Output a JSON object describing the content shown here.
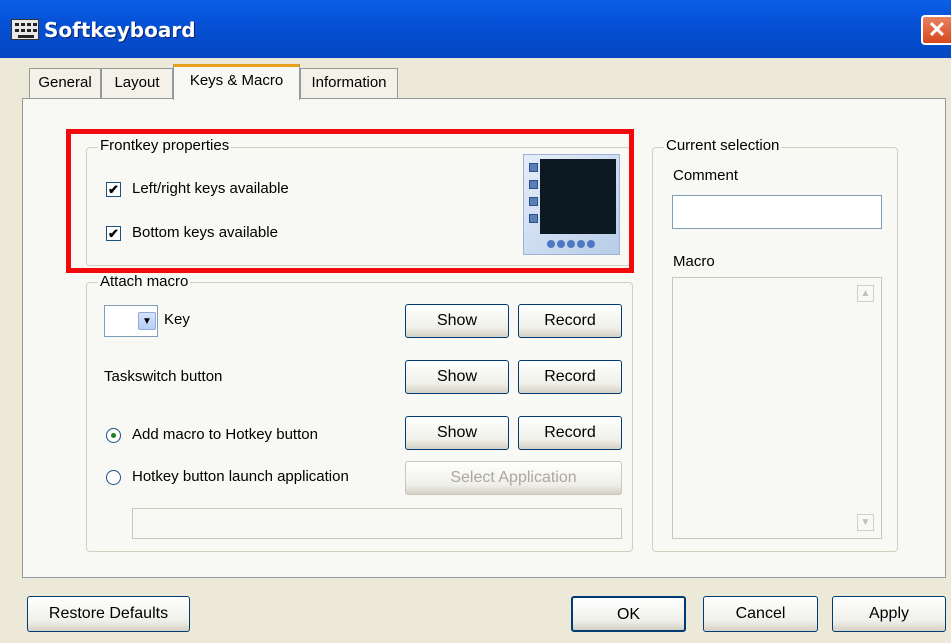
{
  "window": {
    "title": "Softkeyboard",
    "close_glyph": "✕",
    "icon": "keyboard-icon"
  },
  "tabs": [
    {
      "label": "General",
      "active": false
    },
    {
      "label": "Layout",
      "active": false
    },
    {
      "label": "Keys & Macro",
      "active": true
    },
    {
      "label": "Information",
      "active": false
    }
  ],
  "frontkey": {
    "label": "Frontkey properties",
    "left_right": {
      "label": "Left/right keys available",
      "checked": true
    },
    "bottom": {
      "label": "Bottom keys available",
      "checked": true
    },
    "check_glyph": "✔"
  },
  "macro": {
    "label": "Attach macro",
    "key_label": "Key",
    "key_value": "",
    "taskswitch_label": "Taskswitch button",
    "add_hotkey": {
      "label": "Add macro to Hotkey button",
      "selected": true
    },
    "launch_app": {
      "label": "Hotkey button launch application",
      "selected": false
    },
    "show_label": "Show",
    "record_label": "Record",
    "select_app_label": "Select Application",
    "app_path": ""
  },
  "selection": {
    "label": "Current selection",
    "comment_label": "Comment",
    "comment_value": "",
    "macro_label": "Macro",
    "macro_value": ""
  },
  "footer": {
    "restore": "Restore Defaults",
    "ok": "OK",
    "cancel": "Cancel",
    "apply": "Apply"
  },
  "colors": {
    "highlight": "#F20A0A",
    "titlebar": "#0651D6",
    "tab_active_accent": "#E7A01B"
  }
}
